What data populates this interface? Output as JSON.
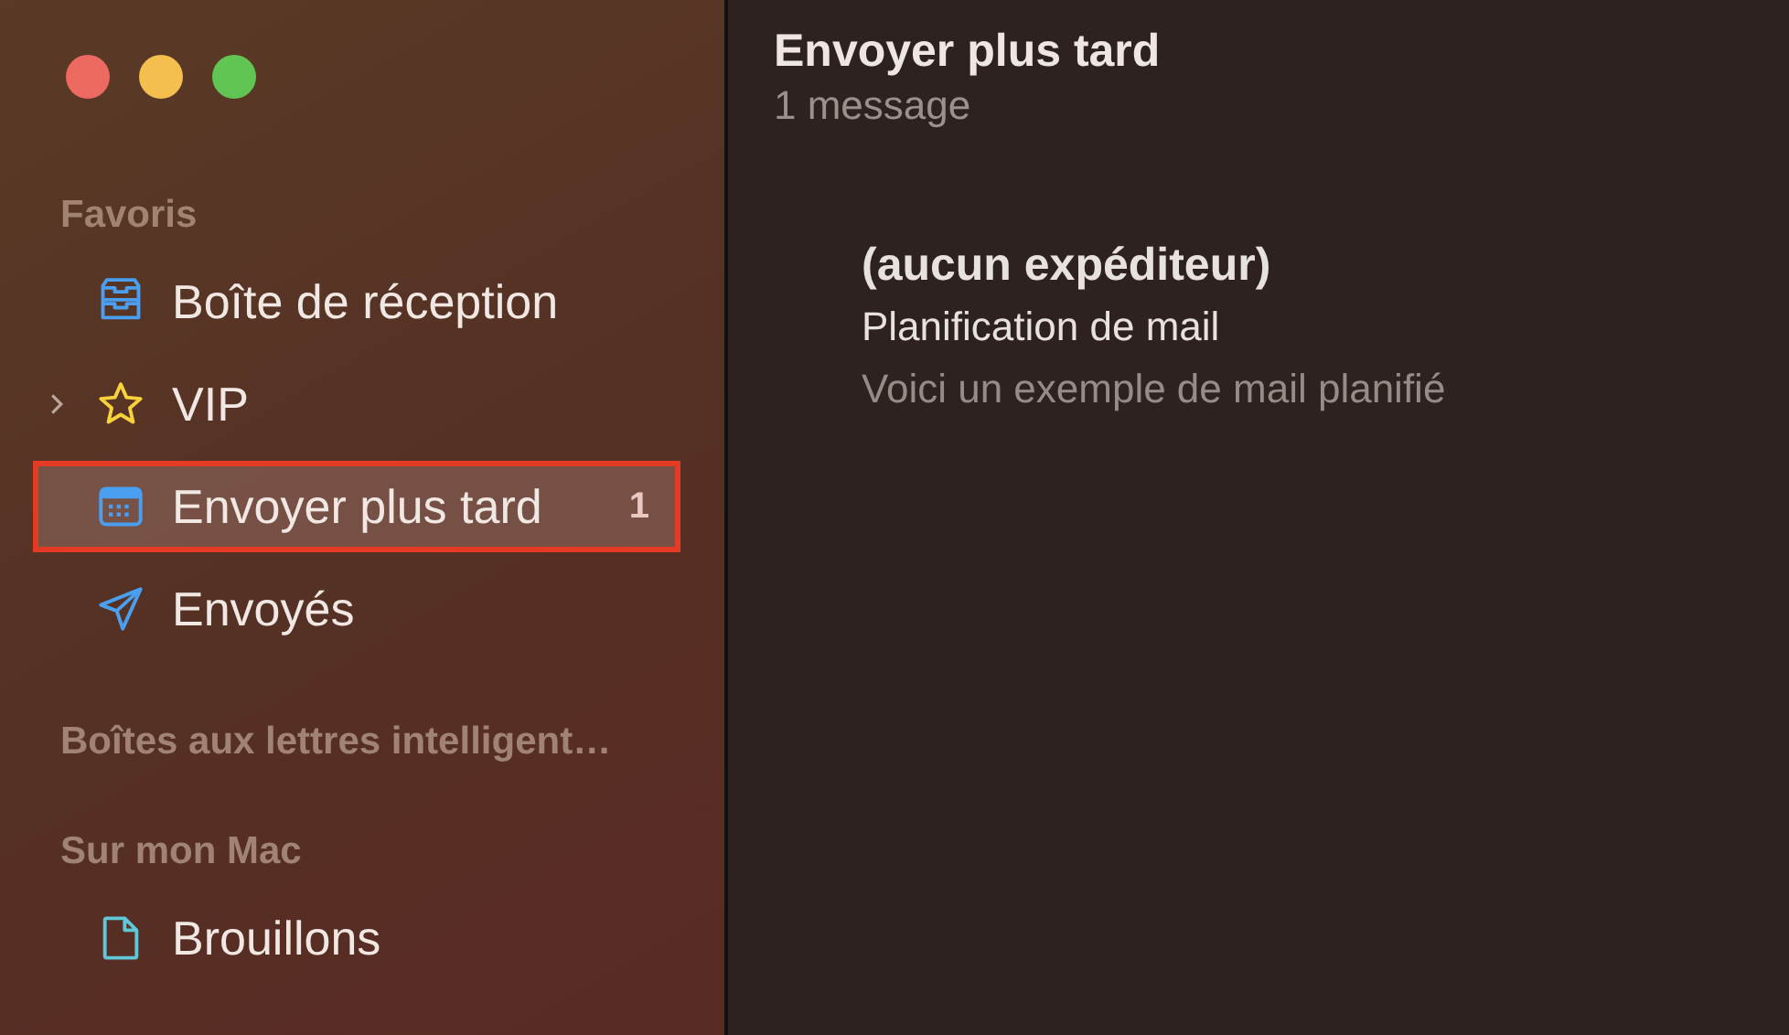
{
  "window": {
    "controls": [
      {
        "color": "#ec6a5f"
      },
      {
        "color": "#f4bf4f"
      },
      {
        "color": "#61c554"
      }
    ]
  },
  "sidebar": {
    "sections": [
      {
        "title": "Favoris",
        "items": [
          {
            "label": "Boîte de réception",
            "kind": "inbox",
            "disclosure": false,
            "selected": false
          },
          {
            "label": "VIP",
            "kind": "star",
            "disclosure": true,
            "selected": false
          },
          {
            "label": "Envoyer plus tard",
            "kind": "calendar",
            "disclosure": false,
            "selected": true,
            "badge": "1"
          },
          {
            "label": "Envoyés",
            "kind": "send",
            "disclosure": false,
            "selected": false
          }
        ]
      },
      {
        "title": "Boîtes aux lettres intelligent…"
      },
      {
        "title": "Sur mon Mac",
        "items": [
          {
            "label": "Brouillons",
            "kind": "document",
            "disclosure": false,
            "selected": false
          }
        ]
      }
    ]
  },
  "message_list": {
    "title": "Envoyer plus tard",
    "count": "1 message",
    "messages": [
      {
        "sender": "(aucun expéditeur)",
        "subject": "Planification de mail",
        "preview": "Voici un exemple de mail planifié"
      }
    ]
  }
}
